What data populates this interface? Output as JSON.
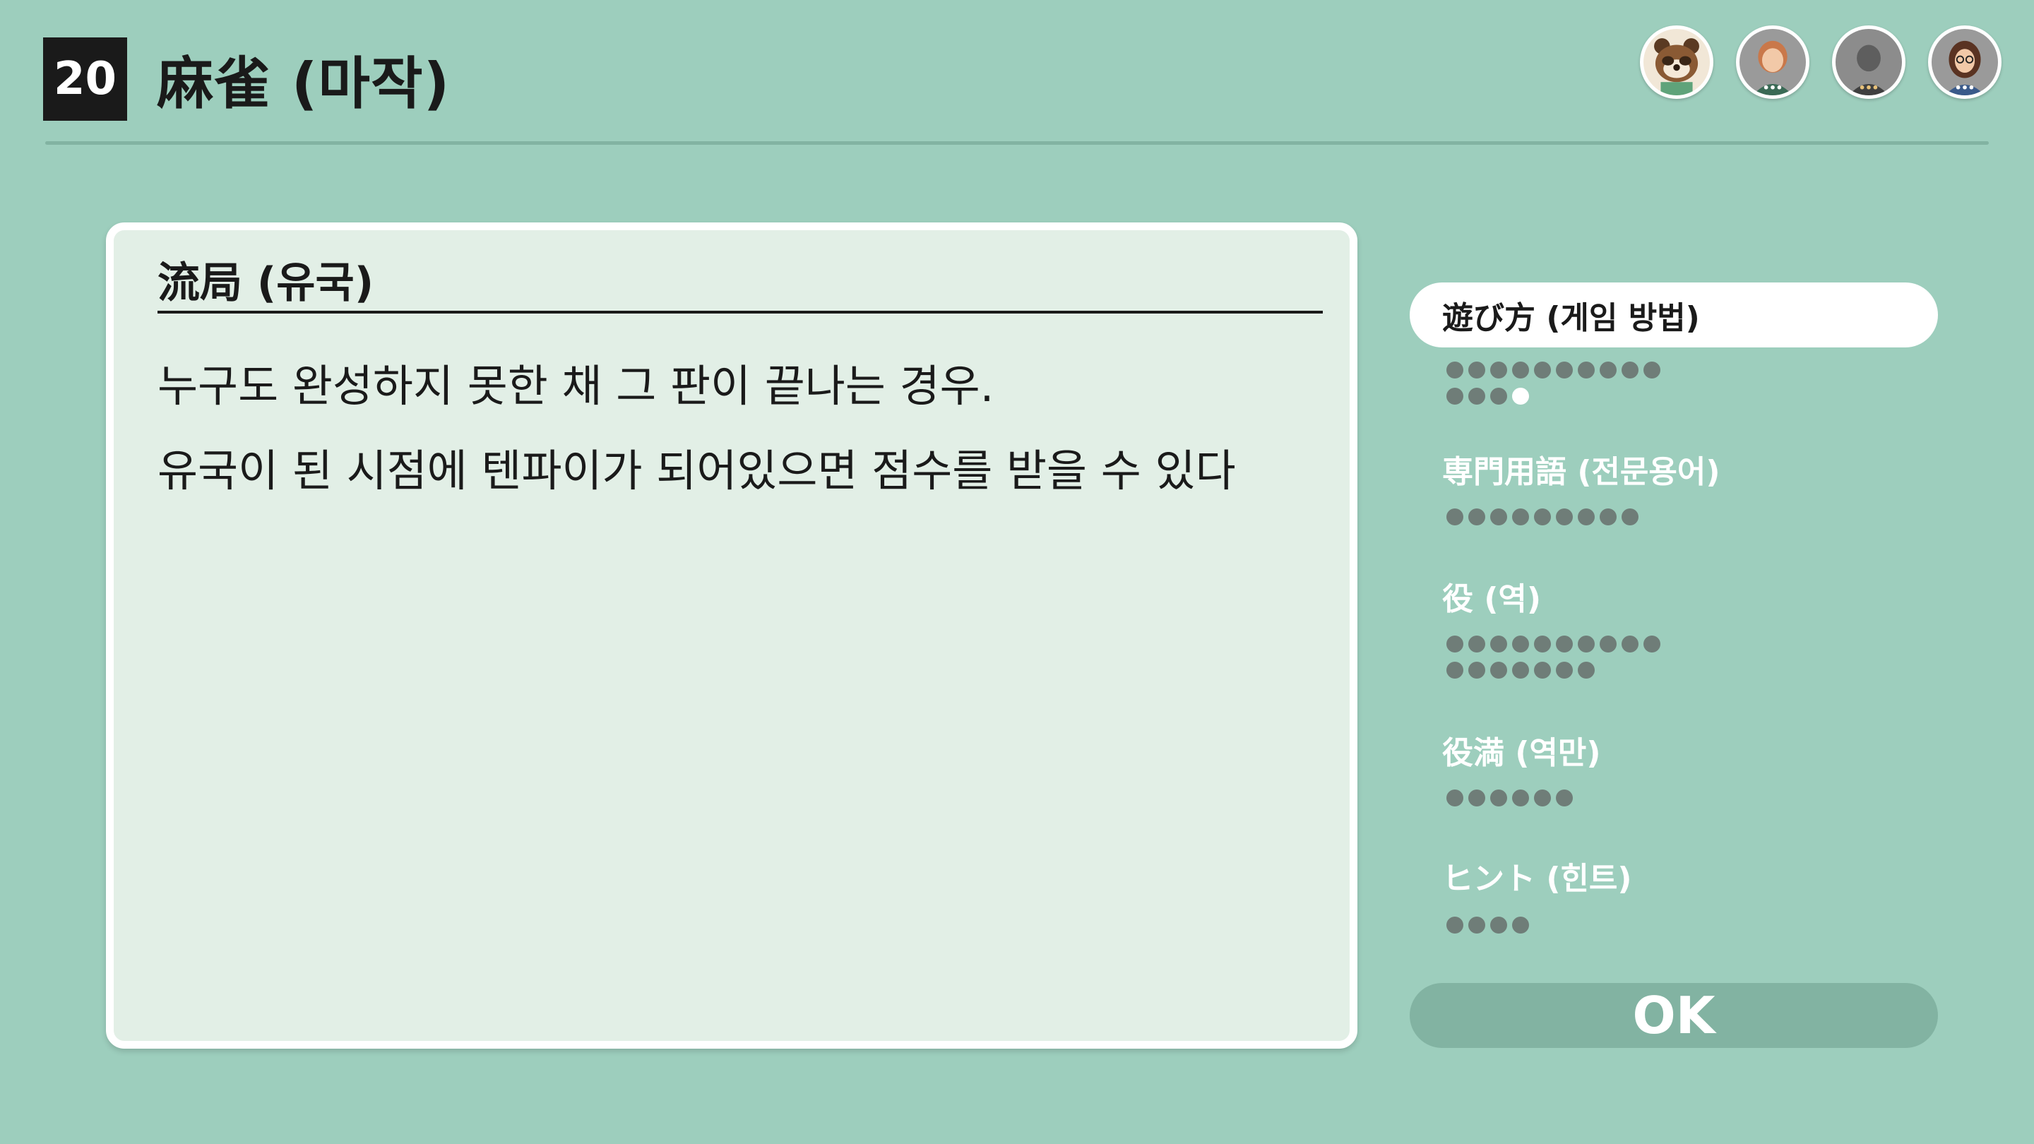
{
  "header": {
    "stage_number": "20",
    "title": "麻雀 (마작)"
  },
  "players": [
    {
      "avatar": "tanuki-shopkeeper-icon"
    },
    {
      "avatar": "player-red-hair-icon"
    },
    {
      "avatar": "player-gray-silhouette-icon"
    },
    {
      "avatar": "player-glasses-icon"
    }
  ],
  "card": {
    "title": "流局 (유국)",
    "lines": [
      "누구도 완성하지 못한 채 그 판이 끝나는 경우.",
      "유국이 된 시점에 텐파이가 되어있으면 점수를 받을 수 있다"
    ]
  },
  "categories": [
    {
      "label": "遊び方 (게임 방법)",
      "selected": true,
      "pages": 14,
      "current_page": 14
    },
    {
      "label": "専門用語 (전문용어)",
      "selected": false,
      "pages": 9
    },
    {
      "label": "役 (역)",
      "selected": false,
      "pages": 17
    },
    {
      "label": "役満 (역만)",
      "selected": false,
      "pages": 6
    },
    {
      "label": "ヒント (힌트)",
      "selected": false,
      "pages": 4
    }
  ],
  "ok_button": {
    "label": "OK"
  },
  "colors": {
    "background": "#9dcebd",
    "card": "#e2efe6",
    "dot": "#6f7d78",
    "ok_button": "#82b3a2"
  }
}
